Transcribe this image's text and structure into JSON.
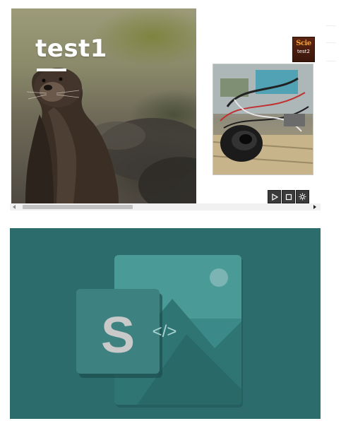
{
  "gallery": {
    "main_title": "test1",
    "thumbnail_caption": "test2",
    "thumbnail_logo_text": "Scie",
    "controls": [
      {
        "name": "play-button",
        "icon": "play-icon"
      },
      {
        "name": "fullscreen-button",
        "icon": "square-icon"
      },
      {
        "name": "settings-button",
        "icon": "gear-icon"
      }
    ],
    "scrollbar_position": 0.0
  },
  "sway_placeholder": {
    "letter": "S",
    "code_symbol": "</>",
    "background_color": "#2d6c6c",
    "icon": "sway-image-placeholder-icon"
  }
}
